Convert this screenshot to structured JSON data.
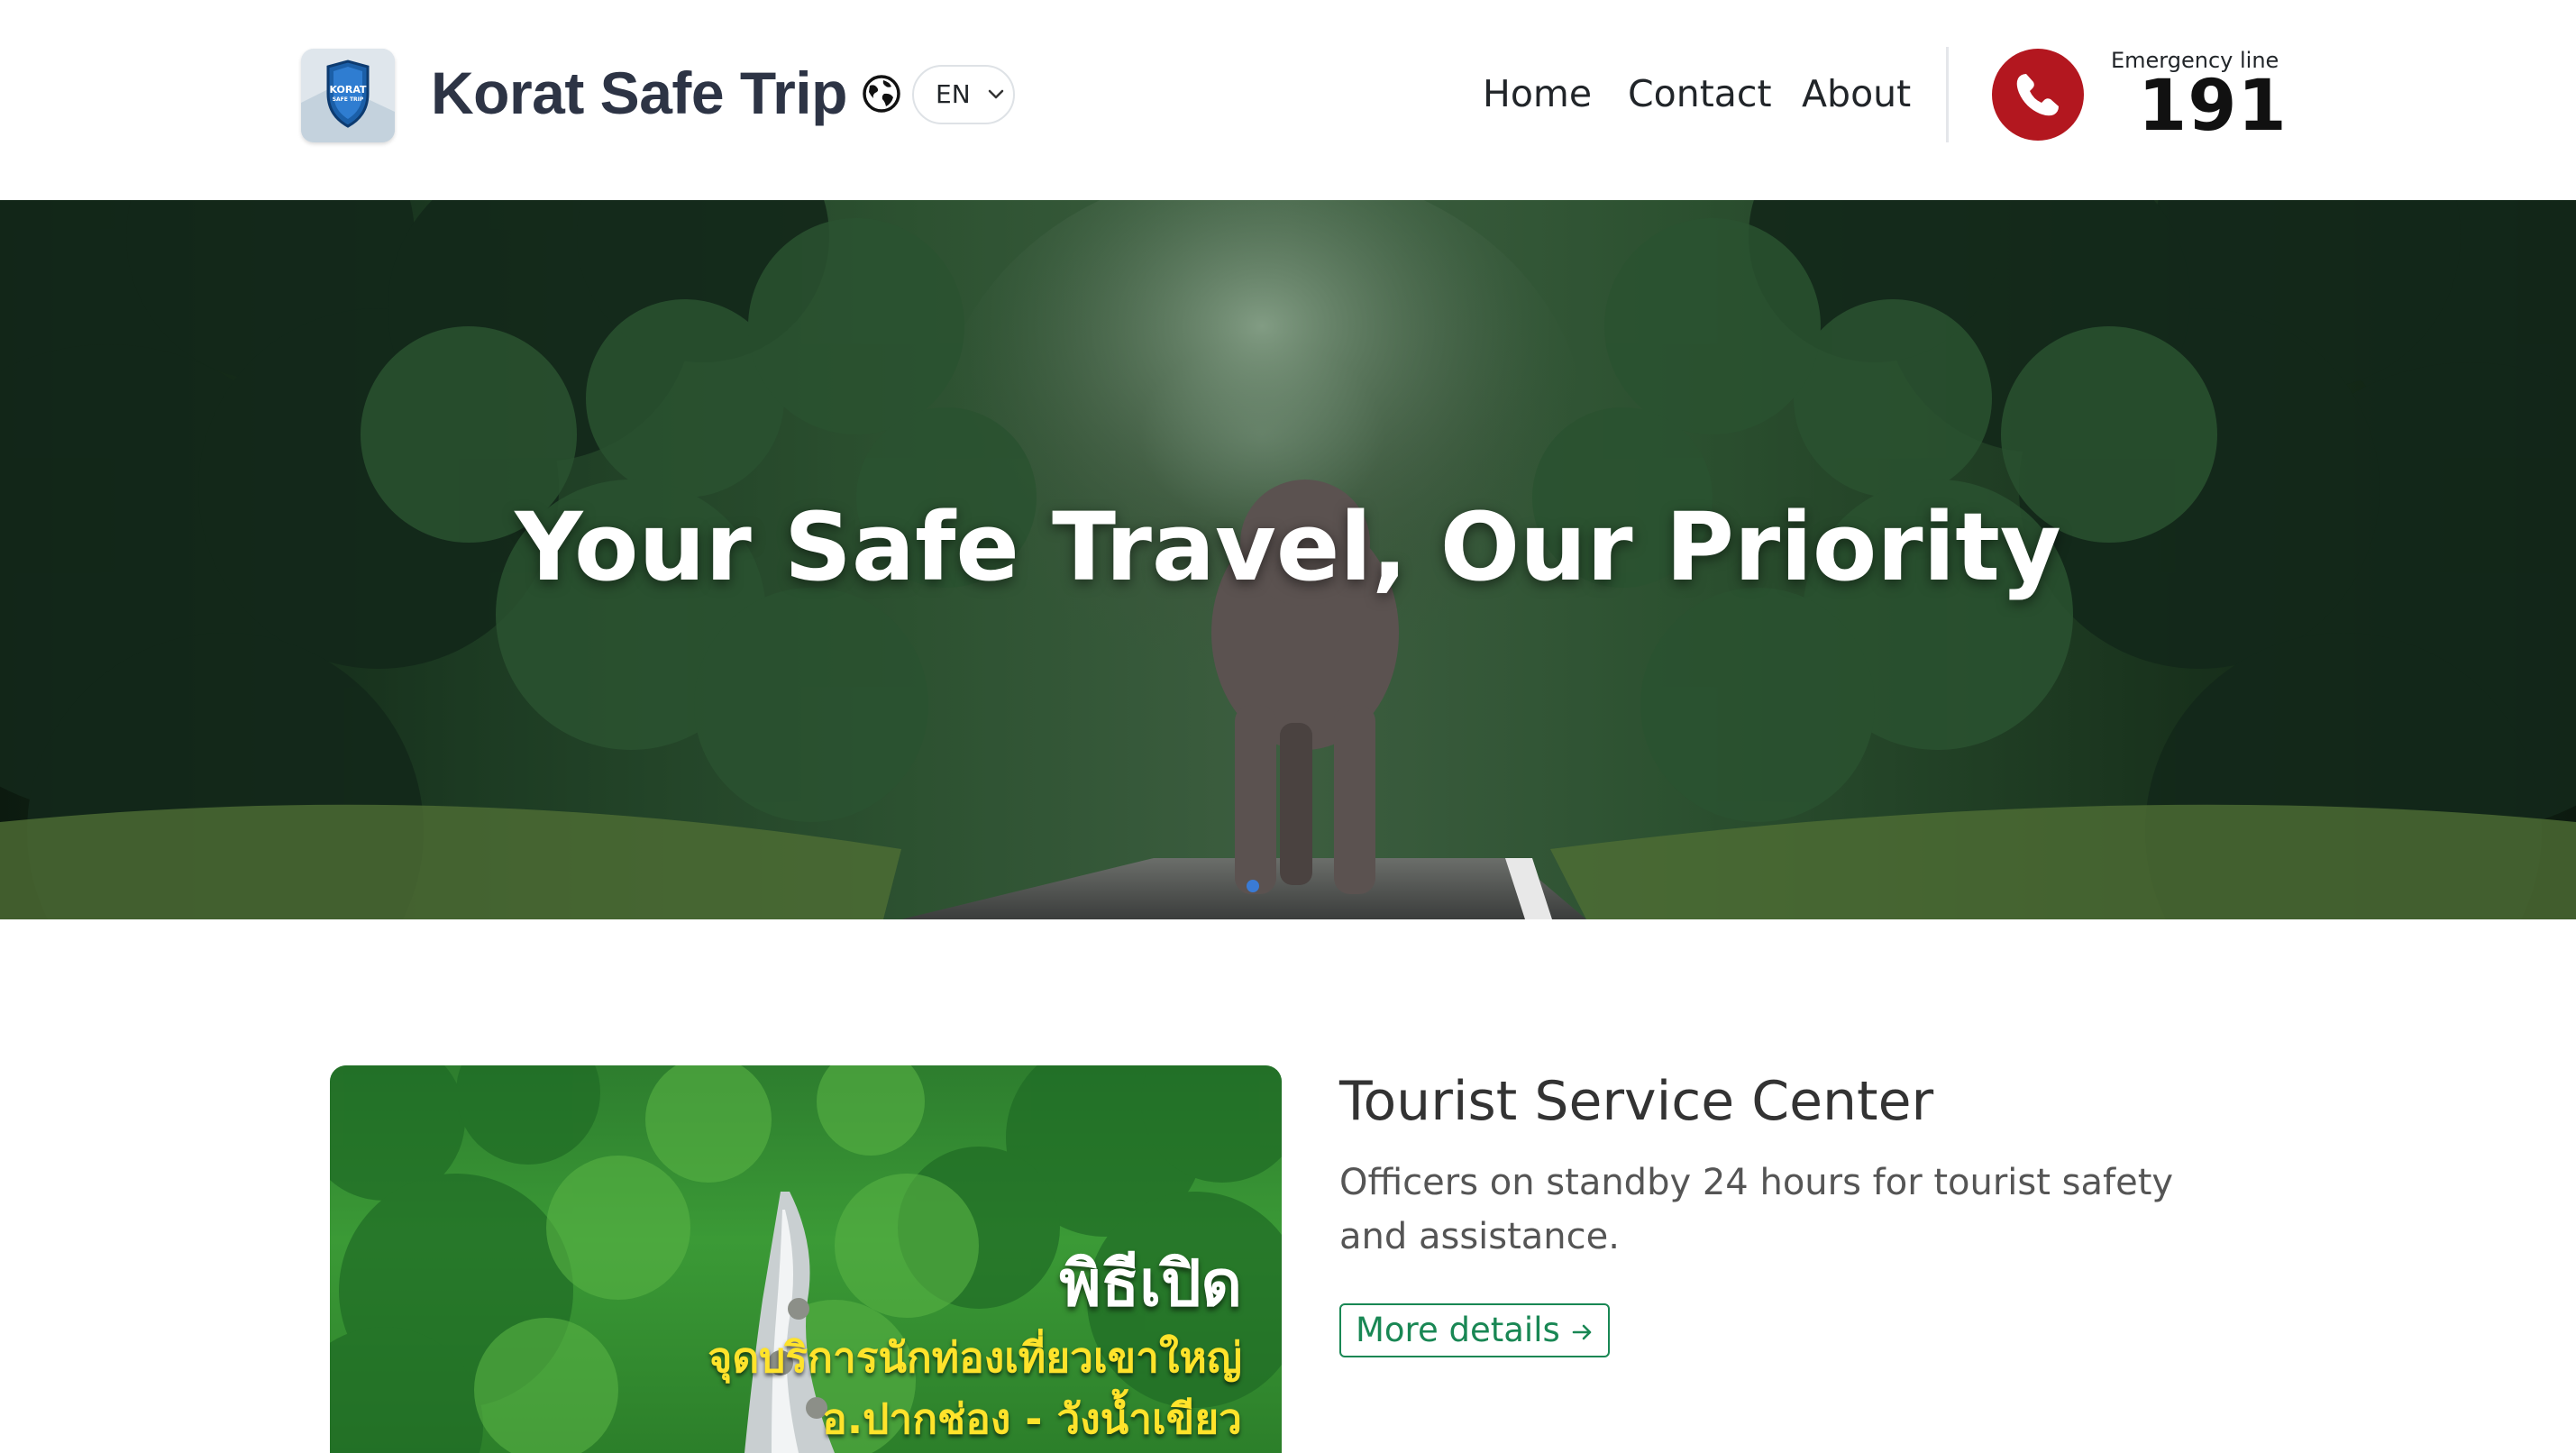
{
  "header": {
    "logo_text_line1": "KORAT",
    "logo_text_line2": "SAFE TRIP",
    "brand": "Korat Safe Trip",
    "language": {
      "selected": "EN",
      "icon": "globe-icon"
    },
    "nav": [
      {
        "label": "Home"
      },
      {
        "label": "Contact"
      },
      {
        "label": "About"
      }
    ],
    "emergency": {
      "label": "Emergency line",
      "number": "191",
      "icon": "phone-icon",
      "icon_bg": "#b3171f"
    }
  },
  "hero": {
    "title": "Your Safe Travel, Our Priority"
  },
  "service": {
    "title": "Tourist Service Center",
    "description": "Officers on standby 24 hours for tourist safety and assistance.",
    "button_label": "More details",
    "button_icon": "arrow-right-icon",
    "accent_color": "#198754",
    "poster": {
      "line1": "พิธีเปิด",
      "line2": "จุดบริการนักท่องเที่ยวเขาใหญ่",
      "line3": "อ.ปากช่อง - วังน้ำเขียว"
    }
  }
}
